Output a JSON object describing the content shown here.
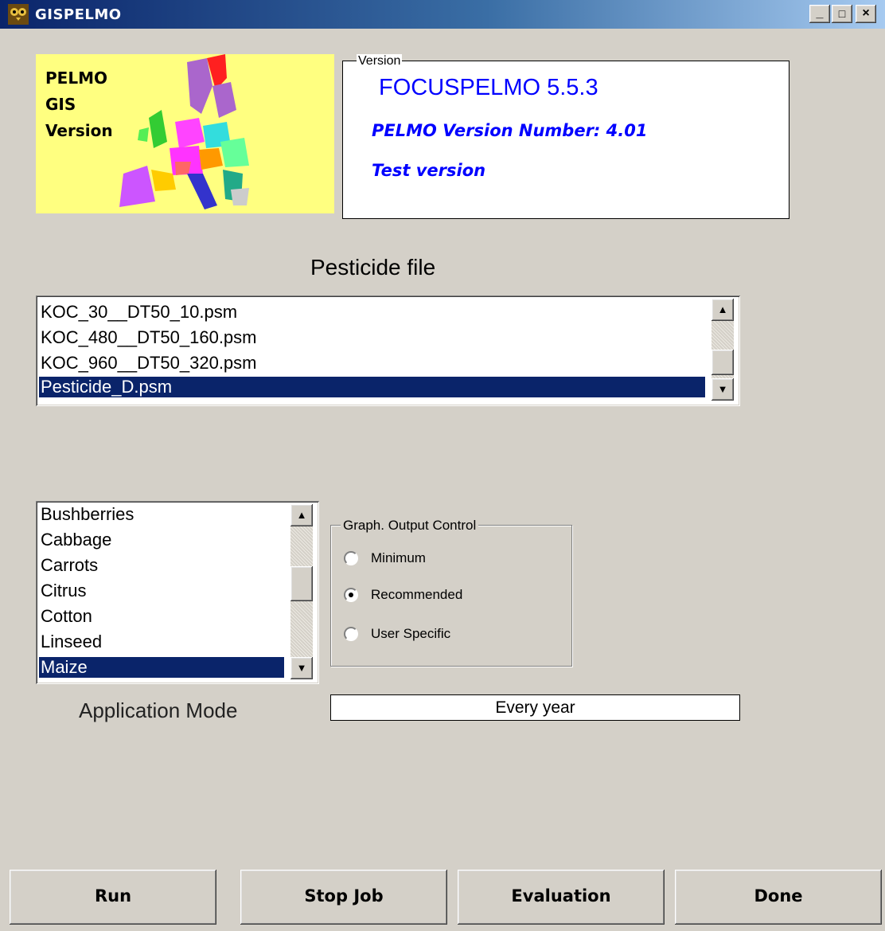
{
  "window": {
    "title": "GISPELMO",
    "minimize": "_",
    "maximize": "□",
    "close": "×"
  },
  "logo": {
    "line1": "PELMO",
    "line2": "GIS",
    "line3": "Version"
  },
  "version": {
    "legend": "Version",
    "product": "FOCUSPELMO 5.5.3",
    "pelmo_version": "PELMO Version Number: 4.01",
    "note": "Test version"
  },
  "pesticide": {
    "heading": "Pesticide file",
    "items": [
      "KOC_30__DT50_10.psm",
      "KOC_480__DT50_160.psm",
      "KOC_960__DT50_320.psm",
      "Pesticide_D.psm"
    ],
    "selected": "Pesticide_D.psm"
  },
  "crops": {
    "items": [
      "Bushberries",
      "Cabbage",
      "Carrots",
      "Citrus",
      "Cotton",
      "Linseed",
      "Maize"
    ],
    "selected": "Maize"
  },
  "graph_output": {
    "legend": "Graph. Output Control",
    "options": [
      "Minimum",
      "Recommended",
      "User Specific"
    ],
    "selected": "Recommended"
  },
  "application_mode": {
    "label": "Application Mode",
    "value": "Every year"
  },
  "buttons": {
    "run": "Run",
    "stop_job": "Stop Job",
    "evaluation": "Evaluation",
    "done": "Done"
  },
  "scroll_arrows": {
    "up": "▲",
    "down": "▼"
  },
  "icons": {
    "app": "owl-icon"
  }
}
